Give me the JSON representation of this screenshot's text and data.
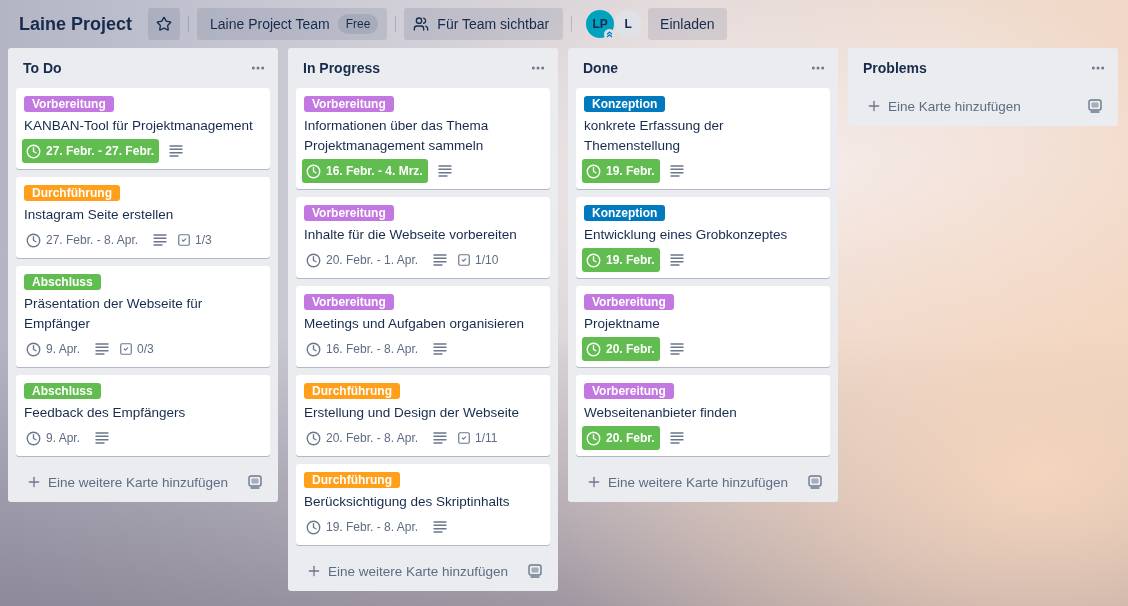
{
  "board": {
    "title": "Laine Project",
    "starred": false,
    "team": {
      "name": "Laine Project Team",
      "plan": "Free"
    },
    "visibility": "Für Team sichtbar",
    "members": [
      {
        "initials": "LP",
        "color": "#00a2be",
        "admin": true
      },
      {
        "initials": "L",
        "color": "#dfe1e6",
        "admin": false
      }
    ],
    "invite": "Einladen"
  },
  "lists": [
    {
      "title": "To Do",
      "cards": [
        {
          "label": {
            "text": "Vorbereitung",
            "color": "#c377e0"
          },
          "title": "KANBAN-Tool für Projektmanagement",
          "due": {
            "text": "27. Febr. - 27. Febr.",
            "complete": true
          },
          "description": true
        },
        {
          "label": {
            "text": "Durchführung",
            "color": "#ff9f1a"
          },
          "title": "Instagram Seite erstellen",
          "due": {
            "text": "27. Febr. - 8. Apr.",
            "complete": false
          },
          "description": true,
          "checklist": "1/3"
        },
        {
          "label": {
            "text": "Abschluss",
            "color": "#61bd4f"
          },
          "title": "Präsentation der Webseite für Empfänger",
          "due": {
            "text": "9. Apr.",
            "complete": false
          },
          "description": true,
          "checklist": "0/3"
        },
        {
          "label": {
            "text": "Abschluss",
            "color": "#61bd4f"
          },
          "title": "Feedback des Empfängers",
          "due": {
            "text": "9. Apr.",
            "complete": false
          },
          "description": true
        }
      ],
      "add_card": "Eine weitere Karte hinzufügen"
    },
    {
      "title": "In Progress",
      "cards": [
        {
          "label": {
            "text": "Vorbereitung",
            "color": "#c377e0"
          },
          "title": "Informationen über das Thema Projektmanagement sammeln",
          "due": {
            "text": "16. Febr. - 4. Mrz.",
            "complete": true
          },
          "description": true
        },
        {
          "label": {
            "text": "Vorbereitung",
            "color": "#c377e0"
          },
          "title": "Inhalte für die Webseite vorbereiten",
          "due": {
            "text": "20. Febr. - 1. Apr.",
            "complete": false
          },
          "description": true,
          "checklist": "1/10"
        },
        {
          "label": {
            "text": "Vorbereitung",
            "color": "#c377e0"
          },
          "title": "Meetings und Aufgaben organisieren",
          "due": {
            "text": "16. Febr. - 8. Apr.",
            "complete": false
          },
          "description": true
        },
        {
          "label": {
            "text": "Durchführung",
            "color": "#ff9f1a"
          },
          "title": "Erstellung und Design der Webseite",
          "due": {
            "text": "20. Febr. - 8. Apr.",
            "complete": false
          },
          "description": true,
          "checklist": "1/11"
        },
        {
          "label": {
            "text": "Durchführung",
            "color": "#ff9f1a"
          },
          "title": "Berücksichtigung des Skriptinhalts",
          "due": {
            "text": "19. Febr. - 8. Apr.",
            "complete": false
          },
          "description": true
        }
      ],
      "add_card": "Eine weitere Karte hinzufügen"
    },
    {
      "title": "Done",
      "cards": [
        {
          "label": {
            "text": "Konzeption",
            "color": "#0079bf"
          },
          "title": "konkrete Erfassung der Themenstellung",
          "due": {
            "text": "19. Febr.",
            "complete": true
          },
          "description": true
        },
        {
          "label": {
            "text": "Konzeption",
            "color": "#0079bf"
          },
          "title": "Entwicklung eines Grobkonzeptes",
          "due": {
            "text": "19. Febr.",
            "complete": true
          },
          "description": true
        },
        {
          "label": {
            "text": "Vorbereitung",
            "color": "#c377e0"
          },
          "title": "Projektname",
          "due": {
            "text": "20. Febr.",
            "complete": true
          },
          "description": true
        },
        {
          "label": {
            "text": "Vorbereitung",
            "color": "#c377e0"
          },
          "title": "Webseitenanbieter finden",
          "due": {
            "text": "20. Febr.",
            "complete": true
          },
          "description": true
        }
      ],
      "add_card": "Eine weitere Karte hinzufügen"
    },
    {
      "title": "Problems",
      "add_card": "Eine Karte hinzufügen"
    }
  ]
}
